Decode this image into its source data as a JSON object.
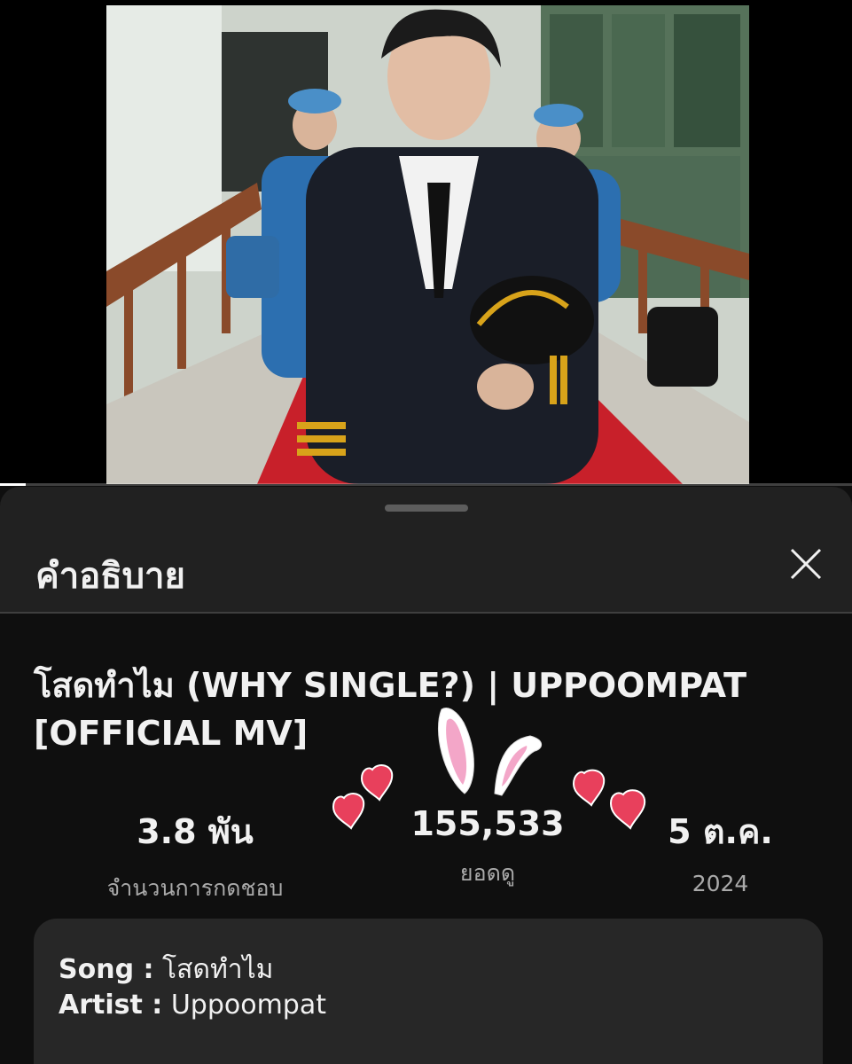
{
  "video": {
    "progress_fraction": 0.03
  },
  "sheet": {
    "title": "คำอธิบาย"
  },
  "description": {
    "title": "โสดทำไม (WHY SINGLE?) | UPPOOMPAT [OFFICIAL MV]",
    "stats": {
      "likes_value": "3.8 พัน",
      "likes_label": "จำนวนการกดชอบ",
      "views_value": "155,533",
      "views_label": "ยอดดู",
      "date_value": "5 ต.ค.",
      "date_year": "2024"
    },
    "lines": [
      {
        "key": "Song :",
        "value": "โสดทำไม"
      },
      {
        "key": "Artist :",
        "value": "Uppoompat"
      }
    ]
  },
  "icons": {
    "close": "close-icon",
    "bunny_ears": "bunny-ears-sticker",
    "hearts": "heart-sticker"
  },
  "colors": {
    "background": "#0f0f0f",
    "sheet": "#212121",
    "card": "#272727",
    "heart": "#e8405c",
    "bunny_inner": "#f3a6c8"
  }
}
